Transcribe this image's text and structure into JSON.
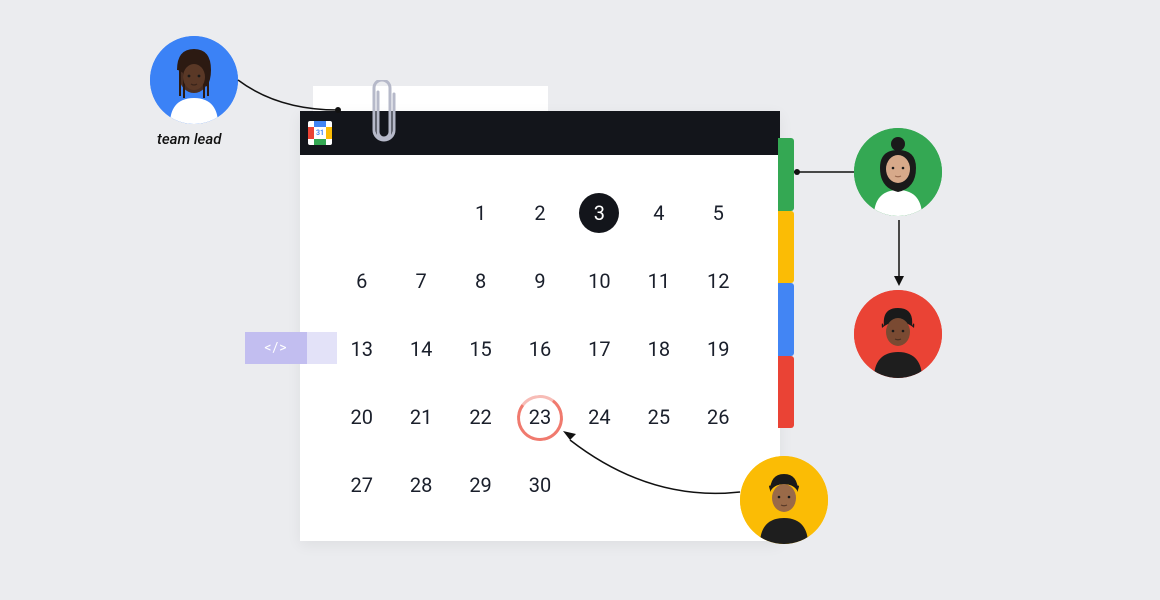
{
  "calendar": {
    "icon_label": "31",
    "days": [
      "",
      "",
      "1",
      "2",
      "3",
      "4",
      "5",
      "6",
      "7",
      "8",
      "9",
      "10",
      "11",
      "12",
      "13",
      "14",
      "15",
      "16",
      "17",
      "18",
      "19",
      "20",
      "21",
      "22",
      "23",
      "24",
      "25",
      "26",
      "27",
      "28",
      "29",
      "30"
    ],
    "selected_index": 4,
    "circled_index": 24
  },
  "code_tag": "</>",
  "labels": {
    "team_lead": "team lead"
  },
  "avatars": {
    "lead": "team-lead",
    "green": "team-member-1",
    "red": "team-member-2",
    "yellow": "team-member-3"
  },
  "colors": {
    "green": "#34A853",
    "yellow": "#FBBC05",
    "blue": "#4285F4",
    "red": "#EA4335",
    "dark": "#13151b"
  }
}
